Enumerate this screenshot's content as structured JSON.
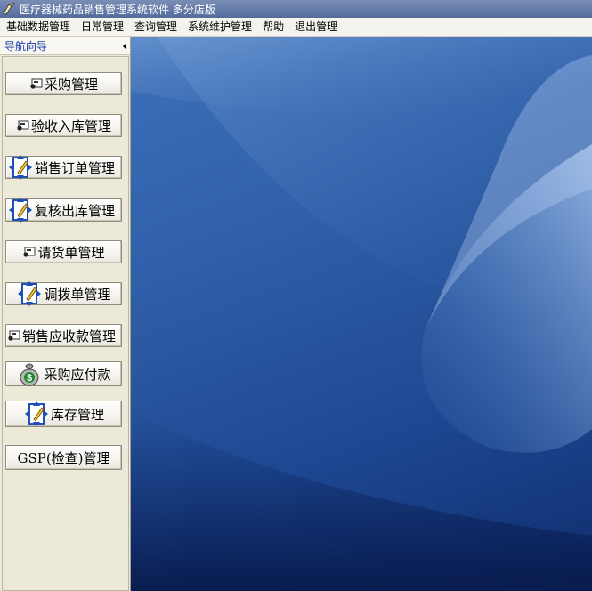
{
  "window": {
    "title": "医疗器械药品销售管理系统软件  多分店版"
  },
  "menu": [
    {
      "label": "基础数据管理"
    },
    {
      "label": "日常管理"
    },
    {
      "label": "查询管理"
    },
    {
      "label": "系统维护管理"
    },
    {
      "label": "帮助"
    },
    {
      "label": "退出管理"
    }
  ],
  "sidebar": {
    "title": "导航向导",
    "buttons": [
      {
        "label": "采购管理",
        "icon": "card-icon"
      },
      {
        "label": "验收入库管理",
        "icon": "card-icon"
      },
      {
        "label": "销售订单管理",
        "icon": "document-pencil-icon"
      },
      {
        "label": "复核出库管理",
        "icon": "document-pencil-icon"
      },
      {
        "label": "请货单管理",
        "icon": "card-icon"
      },
      {
        "label": "调拨单管理",
        "icon": "document-pencil-icon"
      },
      {
        "label": "销售应收款管理",
        "icon": "card-icon"
      },
      {
        "label": "采购应付款",
        "icon": "money-bag-icon"
      },
      {
        "label": "库存管理",
        "icon": "document-pencil-icon"
      },
      {
        "label": "GSP(检查)管理",
        "icon": ""
      }
    ]
  }
}
